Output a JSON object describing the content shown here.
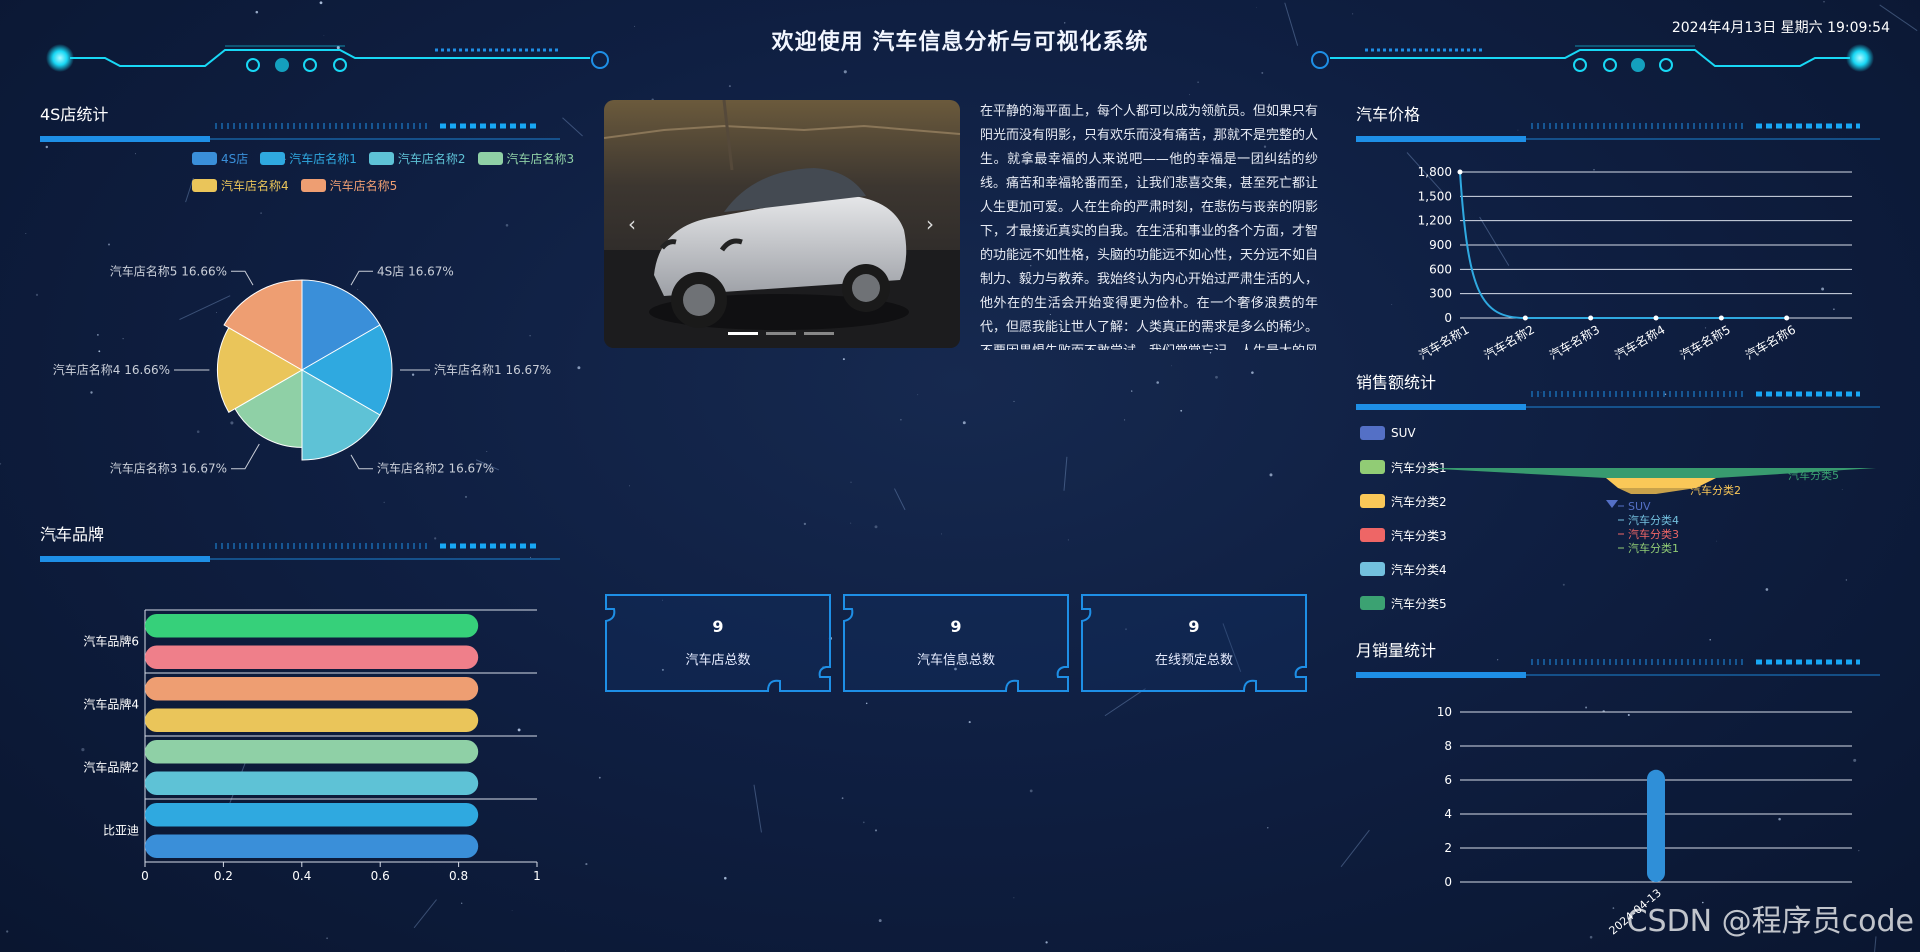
{
  "header": {
    "title": "欢迎使用 汽车信息分析与可视化系统",
    "datetime": "2024年4月13日 星期六 19:09:54"
  },
  "sections": {
    "store_stats": "4S店统计",
    "brand": "汽车品牌",
    "price": "汽车价格",
    "sales": "销售额统计",
    "monthly": "月销量统计"
  },
  "article": {
    "text": "在平静的海平面上，每个人都可以成为领航员。但如果只有阳光而没有阴影，只有欢乐而没有痛苦，那就不是完整的人生。就拿最幸福的人来说吧——他的幸福是一团纠结的纱线。痛苦和幸福轮番而至，让我们悲喜交集，甚至死亡都让人生更加可爱。人在生命的严肃时刻，在悲伤与丧亲的阴影下，才最接近真实的自我。在生活和事业的各个方面，才智的功能远不如性格，头脑的功能远不如心性，天分远不如自制力、毅力与教养。我始终认为内心开始过严肃生活的人，他外在的生活会开始变得更为俭朴。在一个奢侈浪费的年代，但愿我能让世人了解：人类真正的需求是多么的稀少。不要因畏惧失败而不敢尝试，我们常常忘记，人生最大的风险就是不冒险。"
  },
  "carousel": {
    "prev_icon": "‹",
    "next_icon": "›"
  },
  "stats": [
    {
      "value": "9",
      "label": "汽车店总数"
    },
    {
      "value": "9",
      "label": "汽车信息总数"
    },
    {
      "value": "9",
      "label": "在线预定总数"
    }
  ],
  "colors": {
    "accent": "#1e8fe6",
    "cyan": "#18d8f5"
  },
  "chart_data": [
    {
      "id": "store_pie",
      "type": "pie",
      "legend_position": "top",
      "labels": [
        "4S店",
        "汽车店名称1",
        "汽车店名称2",
        "汽车店名称3",
        "汽车店名称4",
        "汽车店名称5"
      ],
      "values": [
        1,
        1,
        1,
        1,
        1,
        1
      ],
      "radii": [
        1.0,
        1.0,
        1.0,
        0.86,
        0.94,
        1.0
      ],
      "label_text": [
        "4S店 16.67%",
        "汽车店名称1 16.67%",
        "汽车店名称2 16.67%",
        "汽车店名称3 16.67%",
        "汽车店名称4 16.66%",
        "汽车店名称5 16.66%"
      ],
      "colors": [
        "#3a8fd9",
        "#2fa9e0",
        "#5ec2d6",
        "#8fd0a6",
        "#eac55a",
        "#ee9e72"
      ]
    },
    {
      "id": "brand_bar",
      "type": "bar",
      "orientation": "horizontal",
      "categories": [
        "比亚迪",
        "",
        "汽车品牌2",
        "",
        "汽车品牌4",
        "",
        "汽车品牌6"
      ],
      "values": [
        0.85,
        0.85,
        0.85,
        0.85,
        0.85,
        0.85,
        0.85,
        0.85
      ],
      "bar_colors": [
        "#3a8fd9",
        "#2fa9e0",
        "#5ec2d6",
        "#8fd0a6",
        "#eac55a",
        "#ee9e72",
        "#ef7f8a",
        "#36d07a"
      ],
      "ytick_labels": [
        "比亚迪",
        "汽车品牌2",
        "汽车品牌4",
        "汽车品牌6"
      ],
      "xlim": [
        0,
        1
      ],
      "xticks": [
        "0",
        "0.2",
        "0.4",
        "0.6",
        "0.8",
        "1"
      ]
    },
    {
      "id": "price_line",
      "type": "line",
      "categories": [
        "汽车名称1",
        "汽车名称2",
        "汽车名称3",
        "汽车名称4",
        "汽车名称5",
        "汽车名称6"
      ],
      "values": [
        1800,
        0,
        0,
        0,
        0,
        0
      ],
      "ylim": [
        0,
        1800
      ],
      "yticks": [
        "0",
        "300",
        "600",
        "900",
        "1,200",
        "1,500",
        "1,800"
      ],
      "color": "#2fa9e0"
    },
    {
      "id": "sales_funnel",
      "type": "funnel",
      "legend_position": "left",
      "series": [
        {
          "name": "SUV",
          "color": "#5470c6"
        },
        {
          "name": "汽车分类1",
          "color": "#91cc75"
        },
        {
          "name": "汽车分类2",
          "color": "#fac858"
        },
        {
          "name": "汽车分类3",
          "color": "#ee6666"
        },
        {
          "name": "汽车分类4",
          "color": "#73c0de"
        },
        {
          "name": "汽车分类5",
          "color": "#3ba272"
        }
      ]
    },
    {
      "id": "monthly_bar",
      "type": "bar",
      "categories": [
        "2024-04-13"
      ],
      "values": [
        6.6
      ],
      "ylim": [
        0,
        10
      ],
      "yticks": [
        "0",
        "2",
        "4",
        "6",
        "8",
        "10"
      ],
      "color": "#2f8fd8"
    }
  ],
  "watermark": "CSDN @程序员code"
}
